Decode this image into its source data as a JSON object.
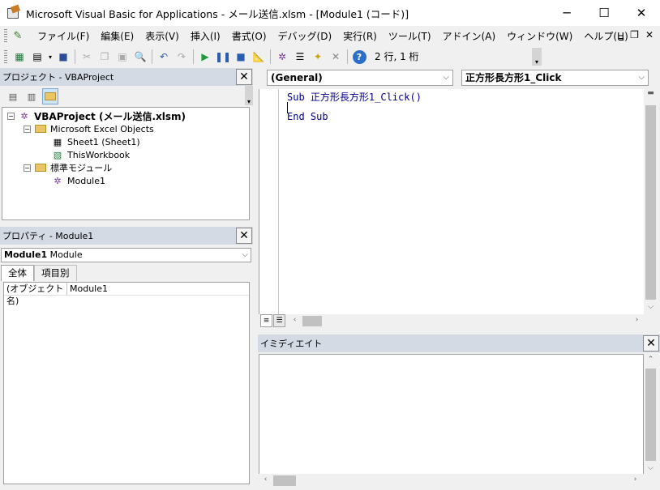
{
  "window": {
    "title": "Microsoft Visual Basic for Applications - メール送信.xlsm - [Module1 (コード)]",
    "minimize": "─",
    "maximize": "☐",
    "close": "✕"
  },
  "menu": {
    "items": [
      "ファイル(F)",
      "編集(E)",
      "表示(V)",
      "挿入(I)",
      "書式(O)",
      "デバッグ(D)",
      "実行(R)",
      "ツール(T)",
      "アドイン(A)",
      "ウィンドウ(W)",
      "ヘルプ(H)"
    ],
    "mdi_minimize": "‗",
    "mdi_restore": "❐",
    "mdi_close": "✕"
  },
  "toolbar": {
    "position_status": "2 行, 1 桁"
  },
  "project_pane": {
    "title": "プロジェクト - VBAProject",
    "close": "✕",
    "tree": {
      "root": "VBAProject (メール送信.xlsm)",
      "excel_objects": "Microsoft Excel Objects",
      "sheet1": "Sheet1 (Sheet1)",
      "this_workbook": "ThisWorkbook",
      "std_modules": "標準モジュール",
      "module1": "Module1"
    }
  },
  "properties_pane": {
    "title": "プロパティ - Module1",
    "close": "✕",
    "object_name": "Module1",
    "object_type": "Module",
    "tabs": [
      "全体",
      "項目別"
    ],
    "rows": [
      {
        "name": "(オブジェクト名)",
        "value": "Module1"
      }
    ]
  },
  "code_window": {
    "object_combo": "(General)",
    "procedure_combo": "正方形長方形1_Click",
    "lines": [
      "Sub 正方形長方形1_Click()",
      "",
      "End Sub"
    ]
  },
  "immediate_pane": {
    "title": "イミディエイト",
    "close": "✕"
  }
}
